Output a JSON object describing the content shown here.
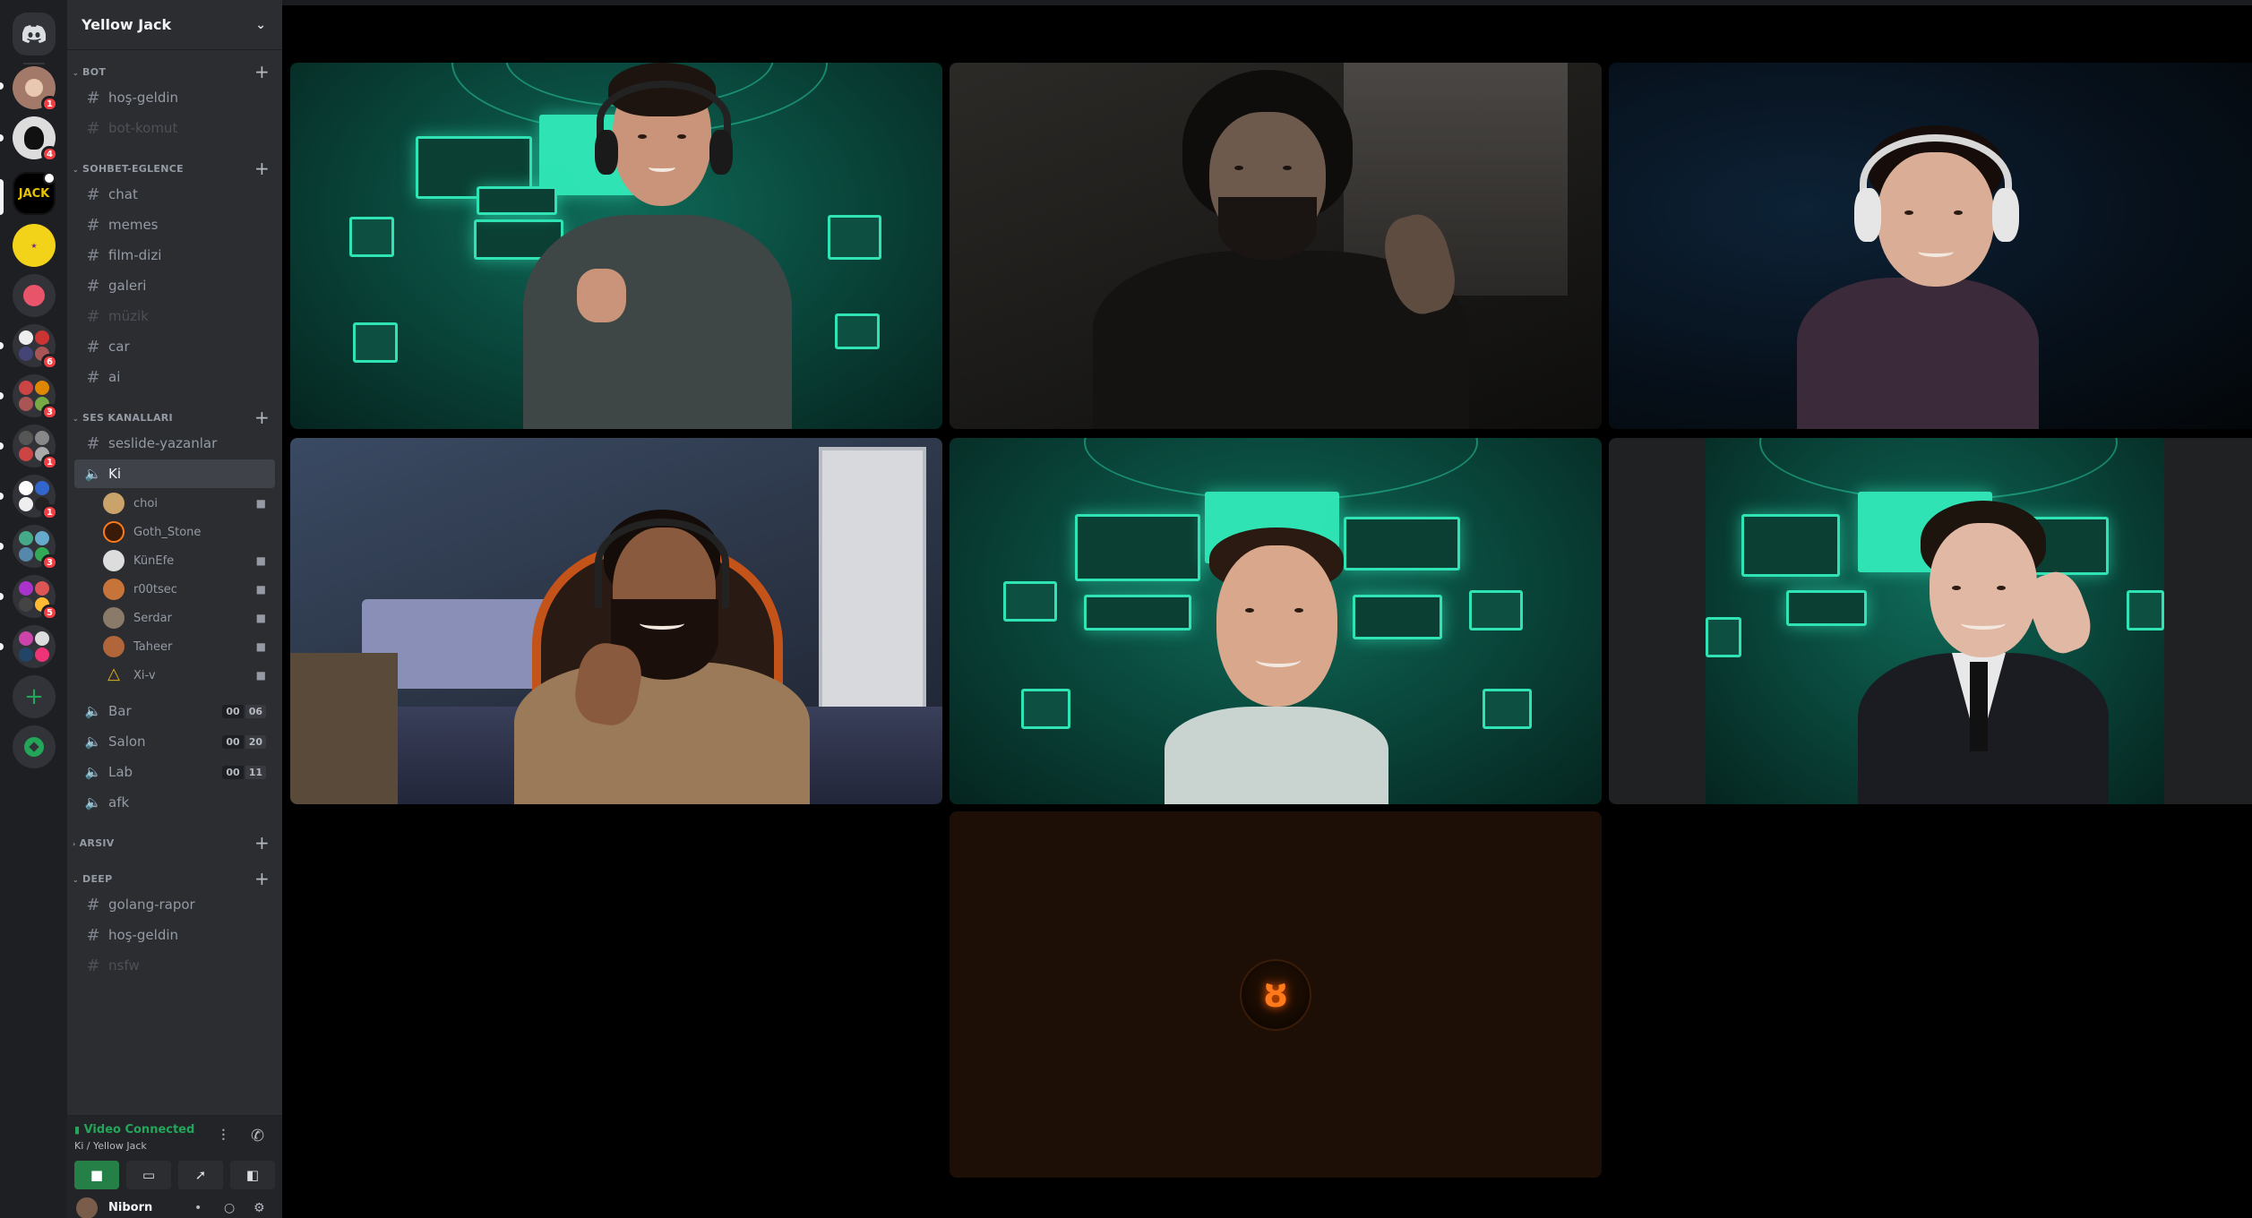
{
  "server": {
    "name": "Yellow Jack"
  },
  "rail": {
    "badges": [
      "1",
      "4",
      "6",
      "3",
      "1",
      "1",
      "3",
      "5"
    ],
    "yellow_jack_label": "JACK"
  },
  "categories": {
    "bot": "BOT",
    "sohbet": "SOHBET-EGLENCE",
    "ses": "SES KANALLARI",
    "arsiv": "ARSIV",
    "deep": "DEEP"
  },
  "channels": {
    "bot": [
      "hoş-geldin",
      "bot-komut"
    ],
    "sohbet": [
      "chat",
      "memes",
      "film-dizi",
      "galeri",
      "müzik",
      "car",
      "ai"
    ],
    "ses_text": "seslide-yazanlar",
    "active_voice": "Ki",
    "voice_users": [
      "choi",
      "Goth_Stone",
      "KünEfe",
      "r00tsec",
      "Serdar",
      "Taheer",
      "Xi-v"
    ],
    "other_voice": [
      {
        "name": "Bar",
        "count": [
          "00",
          "06"
        ]
      },
      {
        "name": "Salon",
        "count": [
          "00",
          "20"
        ]
      },
      {
        "name": "Lab",
        "count": [
          "00",
          "11"
        ]
      },
      {
        "name": "afk"
      }
    ],
    "deep": [
      "golang-rapor",
      "hoş-geldin",
      "nsfw"
    ]
  },
  "voice_panel": {
    "status": "Video Connected",
    "location": "Ki / Yellow Jack"
  },
  "user_panel": {
    "username": "Niborn"
  },
  "colors": {
    "accent_green": "#23a55a",
    "teal_set": "#2fe3b4",
    "notification_red": "#f23f43",
    "sidebar_bg": "#2b2d31",
    "rail_bg": "#1e1f22"
  },
  "icons": {
    "discord_home": "discord-logo-icon",
    "add_server": "plus-icon",
    "discover": "compass-icon",
    "hash": "hash-icon",
    "speaker": "speaker-icon",
    "camera": "video-camera-icon"
  },
  "video_tiles": [
    {
      "label": "participant-1"
    },
    {
      "label": "participant-2"
    },
    {
      "label": "participant-3"
    },
    {
      "label": "participant-4"
    },
    {
      "label": "participant-5"
    },
    {
      "label": "participant-6"
    },
    {
      "label": "participant-7-avatar"
    }
  ]
}
